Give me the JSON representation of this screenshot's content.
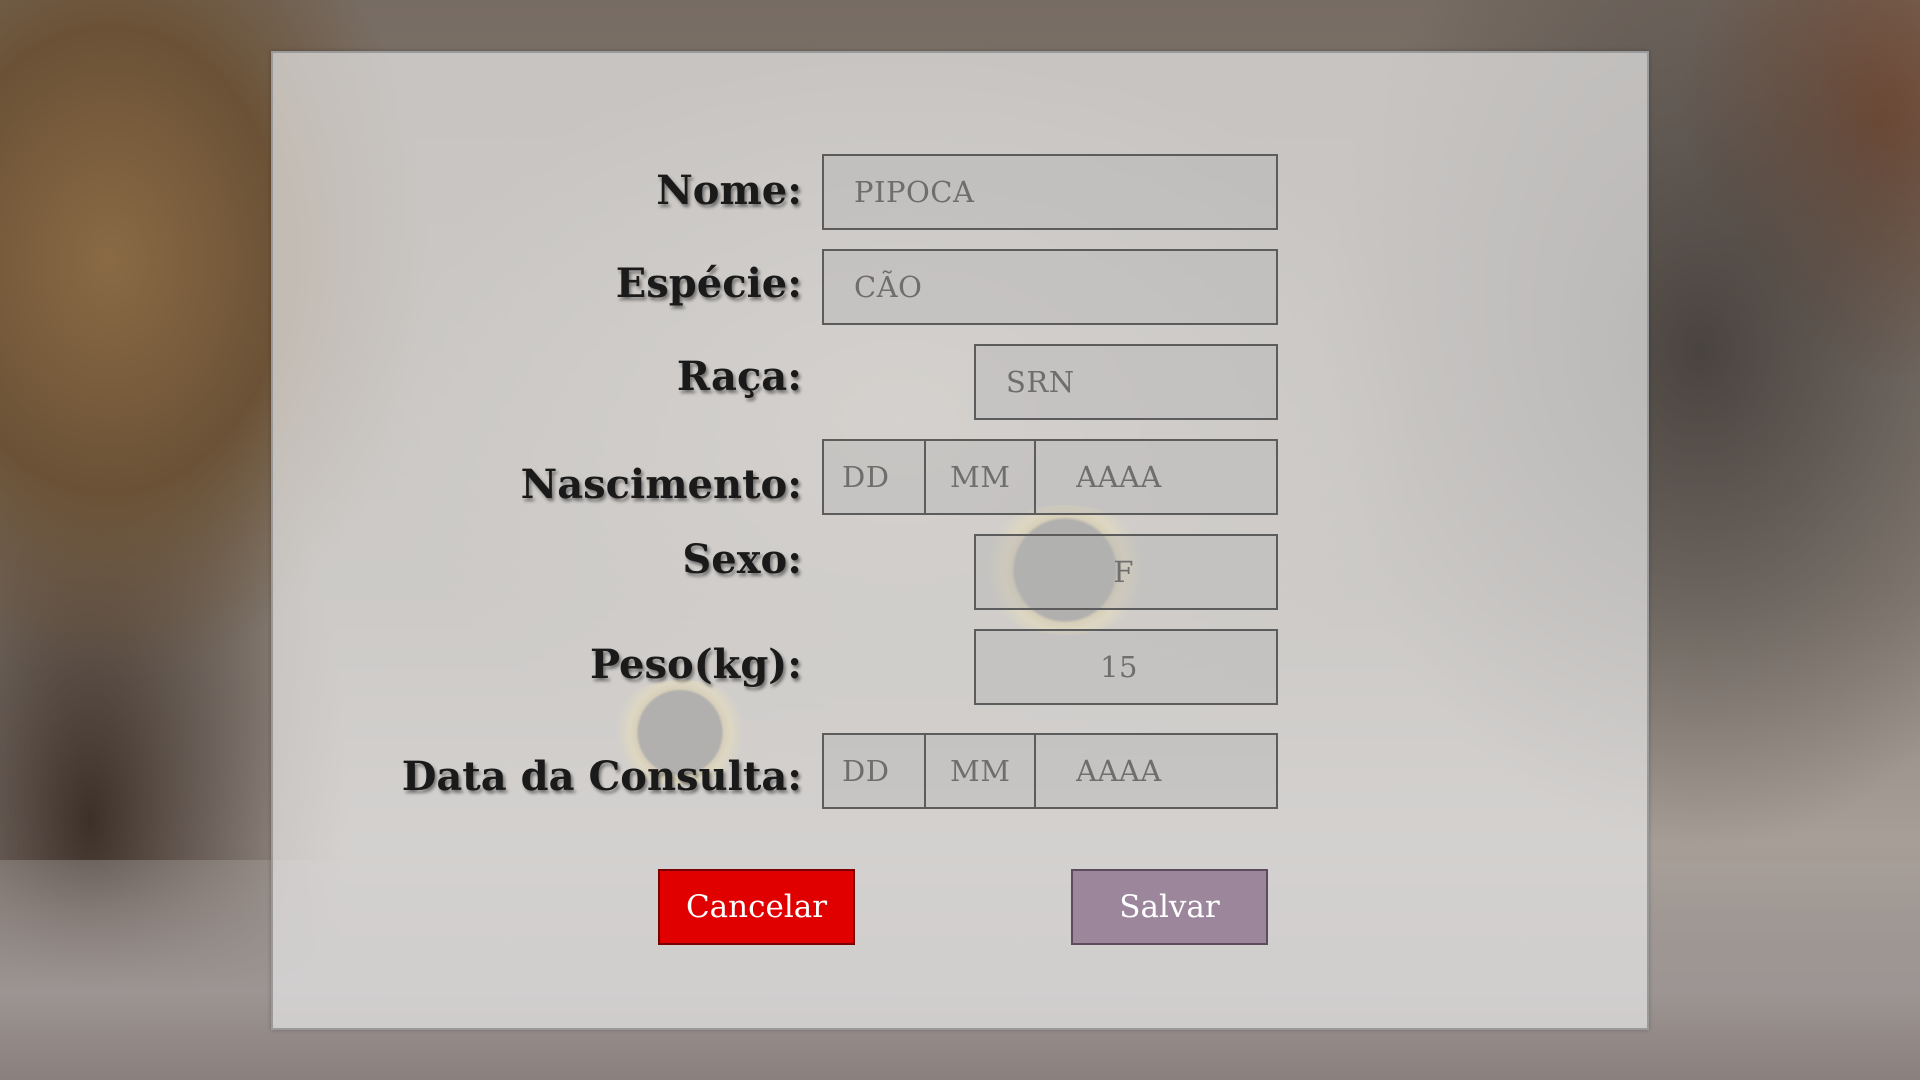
{
  "form": {
    "fields": {
      "nome": {
        "label": "Nome:",
        "value": "PIPOCA"
      },
      "especie": {
        "label": "Espécie:",
        "value": "CÃO"
      },
      "raca": {
        "label": "Raça:",
        "value": "SRN"
      },
      "nascimento": {
        "label": "Nascimento:",
        "day_placeholder": "DD",
        "month_placeholder": "MM",
        "year_placeholder": "AAAA"
      },
      "sexo": {
        "label": "Sexo:",
        "value": "F"
      },
      "peso": {
        "label": "Peso(kg):",
        "value": "15"
      },
      "data_consulta": {
        "label": "Data da Consulta:",
        "day_placeholder": "DD",
        "month_placeholder": "MM",
        "year_placeholder": "AAAA"
      }
    },
    "buttons": {
      "cancel_label": "Cancelar",
      "save_label": "Salvar"
    }
  },
  "colors": {
    "cancel_button": "#e00000",
    "save_button": "#9c869b",
    "panel": "#e4e4e4"
  }
}
